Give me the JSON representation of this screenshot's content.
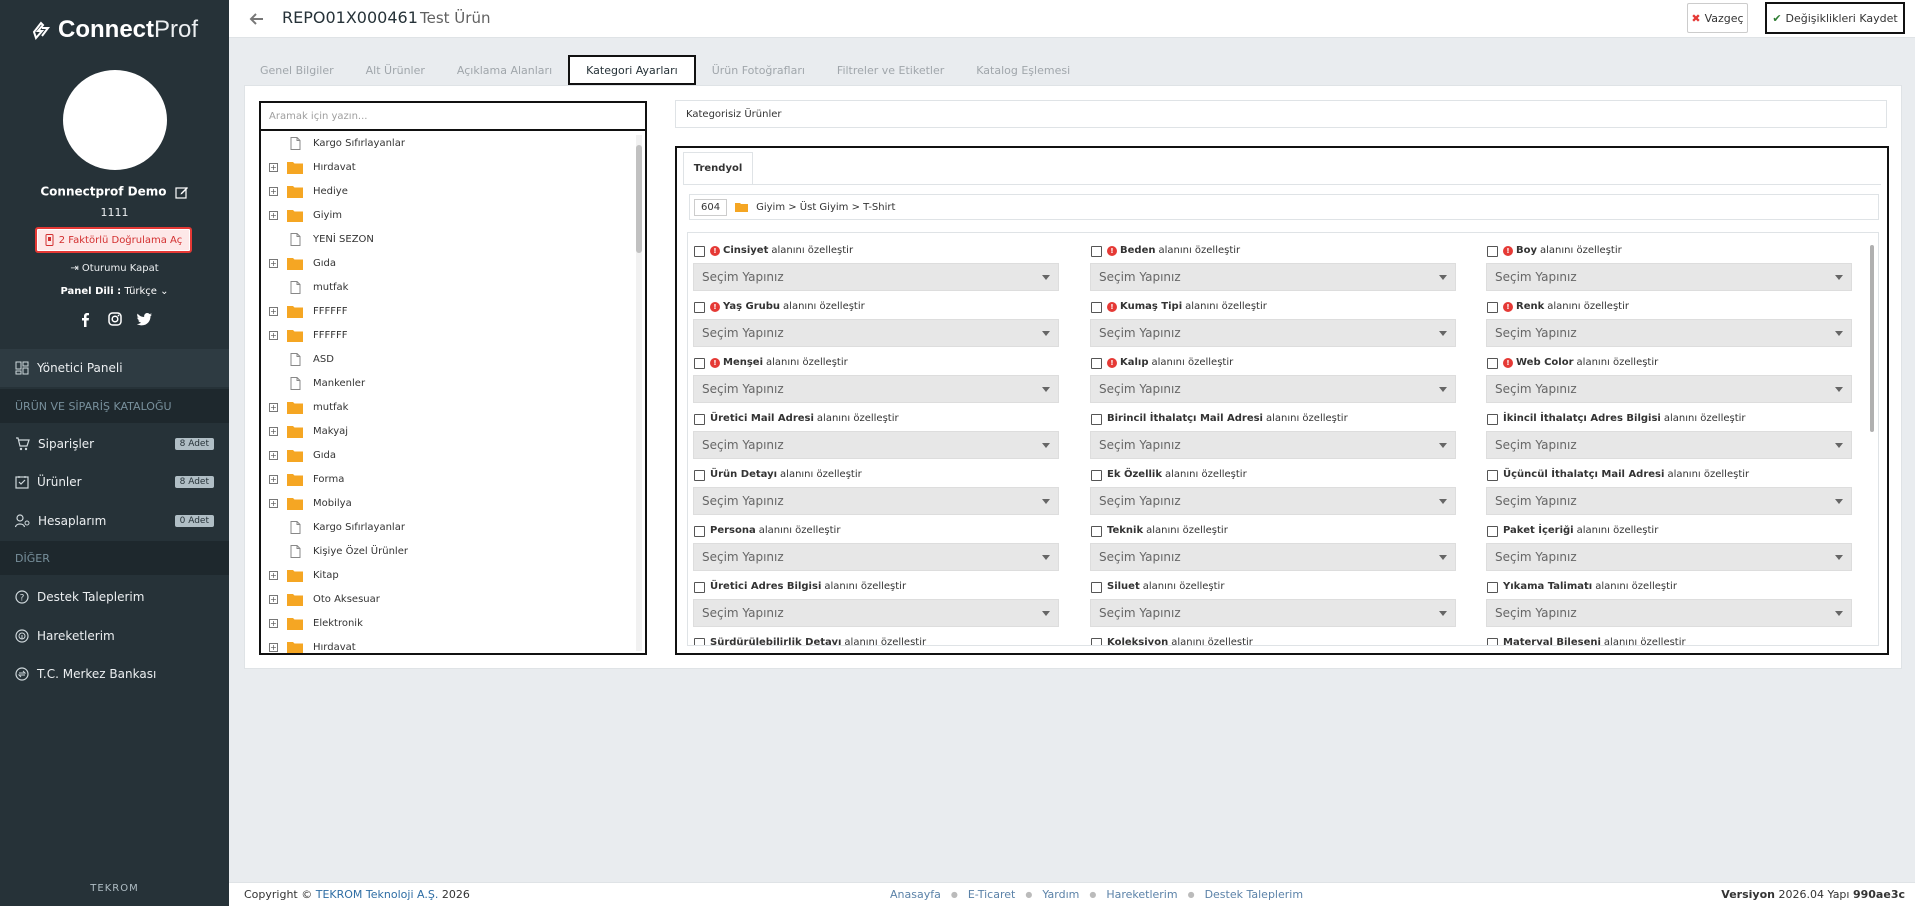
{
  "sidebar": {
    "logo_main": "Connect",
    "logo_sub": "Prof",
    "user_name": "Connectprof Demo",
    "user_code": "1111",
    "twofa_label": "2 Faktörlü Doğrulama Aç",
    "logout_label": "Oturumu Kapat",
    "lang_label": "Panel Dili :",
    "lang_value": "Türkçe",
    "nav_dashboard": "Yönetici Paneli",
    "section_catalog": "ÜRÜN VE SİPARİŞ KATALOĞU",
    "nav_orders": "Siparişler",
    "nav_orders_badge": "8 Adet",
    "nav_products": "Ürünler",
    "nav_products_badge": "8 Adet",
    "nav_accounts": "Hesaplarım",
    "nav_accounts_badge": "0 Adet",
    "section_other": "DİĞER",
    "nav_support": "Destek Taleplerim",
    "nav_movements": "Hareketlerim",
    "nav_bank": "T.C. Merkez Bankası",
    "footer_brand": "TEKROM"
  },
  "topbar": {
    "code": "REPO01X000461",
    "product_name": "Test Ürün",
    "cancel": "Vazgeç",
    "save": "Değişiklikleri Kaydet"
  },
  "tabs": [
    "Genel Bilgiler",
    "Alt Ürünler",
    "Açıklama Alanları",
    "Kategori Ayarları",
    "Ürün Fotoğrafları",
    "Filtreler ve Etiketler",
    "Katalog Eşlemesi"
  ],
  "tree": {
    "search_placeholder": "Aramak için yazın...",
    "nodes": [
      {
        "label": "Kargo Sıfırlayanlar",
        "type": "file"
      },
      {
        "label": "Hırdavat",
        "type": "folder"
      },
      {
        "label": "Hediye",
        "type": "folder"
      },
      {
        "label": "Giyim",
        "type": "folder"
      },
      {
        "label": "YENİ SEZON",
        "type": "file"
      },
      {
        "label": "Gıda",
        "type": "folder"
      },
      {
        "label": "mutfak",
        "type": "file"
      },
      {
        "label": "FFFFFF",
        "type": "folder"
      },
      {
        "label": "FFFFFF",
        "type": "folder"
      },
      {
        "label": "ASD",
        "type": "file"
      },
      {
        "label": "Mankenler",
        "type": "file"
      },
      {
        "label": "mutfak",
        "type": "folder"
      },
      {
        "label": "Makyaj",
        "type": "folder"
      },
      {
        "label": "Gıda",
        "type": "folder"
      },
      {
        "label": "Forma",
        "type": "folder"
      },
      {
        "label": "Mobilya",
        "type": "folder"
      },
      {
        "label": "Kargo Sıfırlayanlar",
        "type": "file"
      },
      {
        "label": "Kişiye Özel Ürünler",
        "type": "file"
      },
      {
        "label": "Kitap",
        "type": "folder"
      },
      {
        "label": "Oto Aksesuar",
        "type": "folder"
      },
      {
        "label": "Elektronik",
        "type": "folder"
      },
      {
        "label": "Hırdavat",
        "type": "folder"
      }
    ]
  },
  "uncategorized": "Kategorisiz Ürünler",
  "marketplace": {
    "tab": "Trendyol",
    "cat_id": "604",
    "cat_path": "Giyim > Üst Giyim > T-Shirt",
    "suffix": "alanını özelleştir",
    "select_placeholder": "Seçim Yapınız",
    "fields": [
      {
        "name": "Cinsiyet",
        "required": true
      },
      {
        "name": "Beden",
        "required": true
      },
      {
        "name": "Boy",
        "required": true
      },
      {
        "name": "Yaş Grubu",
        "required": true
      },
      {
        "name": "Kumaş Tipi",
        "required": true
      },
      {
        "name": "Renk",
        "required": true
      },
      {
        "name": "Menşei",
        "required": true
      },
      {
        "name": "Kalıp",
        "required": true
      },
      {
        "name": "Web Color",
        "required": true
      },
      {
        "name": "Üretici Mail Adresi",
        "required": false
      },
      {
        "name": "Birincil İthalatçı Mail Adresi",
        "required": false
      },
      {
        "name": "İkincil İthalatçı Adres Bilgisi",
        "required": false
      },
      {
        "name": "Ürün Detayı",
        "required": false
      },
      {
        "name": "Ek Özellik",
        "required": false
      },
      {
        "name": "Üçüncül İthalatçı Mail Adresi",
        "required": false
      },
      {
        "name": "Persona",
        "required": false
      },
      {
        "name": "Teknik",
        "required": false
      },
      {
        "name": "Paket İçeriği",
        "required": false
      },
      {
        "name": "Üretici Adres Bilgisi",
        "required": false
      },
      {
        "name": "Siluet",
        "required": false
      },
      {
        "name": "Yıkama Talimatı",
        "required": false
      },
      {
        "name": "Sürdürülebilirlik Detayı",
        "required": false
      },
      {
        "name": "Koleksiyon",
        "required": false
      },
      {
        "name": "Materyal Bileşeni",
        "required": false
      }
    ]
  },
  "footer": {
    "copy_prefix": "Copyright ©",
    "company": "TEKROM Teknoloji A.Ş.",
    "year": "2026",
    "links": [
      "Anasayfa",
      "E-Ticaret",
      "Yardım",
      "Hareketlerim",
      "Destek Taleplerim"
    ],
    "version_label": "Versiyon",
    "version": "2026.04",
    "build_label": "Yapı",
    "build": "990ae3c"
  },
  "colors": {
    "sidebar": "#263238",
    "accent": "#2e6da4",
    "danger": "#e53935",
    "folder": "#f5a623"
  }
}
